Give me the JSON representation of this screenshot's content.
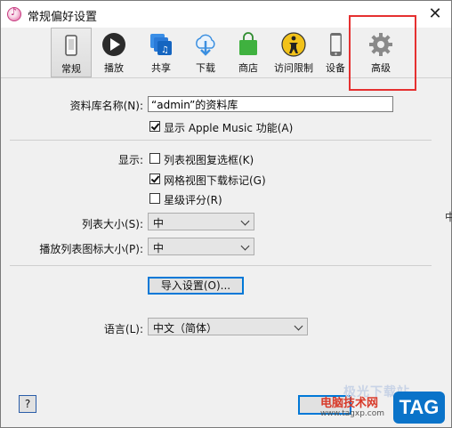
{
  "window": {
    "title": "常规偏好设置",
    "close_glyph": "✕"
  },
  "toolbar": {
    "items": [
      {
        "label": "常规",
        "icon": "phone-switch-icon"
      },
      {
        "label": "播放",
        "icon": "play-icon"
      },
      {
        "label": "共享",
        "icon": "share-icon"
      },
      {
        "label": "下载",
        "icon": "cloud-download-icon"
      },
      {
        "label": "商店",
        "icon": "shopping-bag-icon"
      },
      {
        "label": "访问限制",
        "icon": "restrictions-icon"
      },
      {
        "label": "设备",
        "icon": "device-icon"
      },
      {
        "label": "高级",
        "icon": "gear-icon"
      }
    ]
  },
  "general": {
    "library_name_label": "资料库名称(N):",
    "library_name_value": "“admin”的资料库",
    "show_apple_music": {
      "label": "显示 Apple Music 功能(A)",
      "checked": true
    },
    "show_label": "显示:",
    "list_checkboxes": {
      "label": "列表视图复选框(K)",
      "checked": false
    },
    "grid_badges": {
      "label": "网格视图下载标记(G)",
      "checked": true
    },
    "star_ratings": {
      "label": "星级评分(R)",
      "checked": false
    },
    "list_size_label": "列表大小(S):",
    "list_size_value": "中",
    "playlist_icon_size_label": "播放列表图标大小(P):",
    "playlist_icon_size_value": "中",
    "import_settings_button": "导入设置(O)...",
    "language_label": "语言(L):",
    "language_value": "中文（简体）",
    "help_button": "?"
  },
  "watermark": {
    "line1": "电脑技术网",
    "line2": "www.tagxp.com",
    "faint": "极光下载站",
    "tag": "TAG"
  },
  "colors": {
    "highlight": "#e53030",
    "focus": "#0078d7",
    "tag_blue": "#0a73c9"
  }
}
